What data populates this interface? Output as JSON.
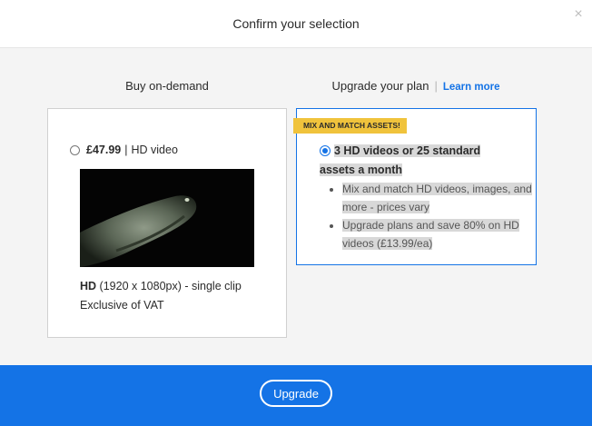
{
  "modal": {
    "title": "Confirm your selection",
    "close_glyph": "×"
  },
  "on_demand": {
    "heading": "Buy on-demand",
    "price": "£47.99",
    "separator": "|",
    "type": "HD video",
    "resolution_label": "HD",
    "resolution_detail": "(1920 x 1080px) - single clip",
    "vat_note": "Exclusive of VAT",
    "selected": false
  },
  "plan": {
    "heading": "Upgrade your plan",
    "separator": "|",
    "learn_more": "Learn more",
    "badge": "MIX AND MATCH ASSETS!",
    "title": "3 HD videos or 25 standard assets a month",
    "selected": true,
    "bullets": [
      "Mix and match HD videos, images, and more - prices vary",
      "Upgrade plans and save 80% on HD videos (£13.99/ea)"
    ]
  },
  "footer": {
    "upgrade_label": "Upgrade"
  },
  "colors": {
    "accent": "#1473e6",
    "badge": "#f0c33c"
  }
}
